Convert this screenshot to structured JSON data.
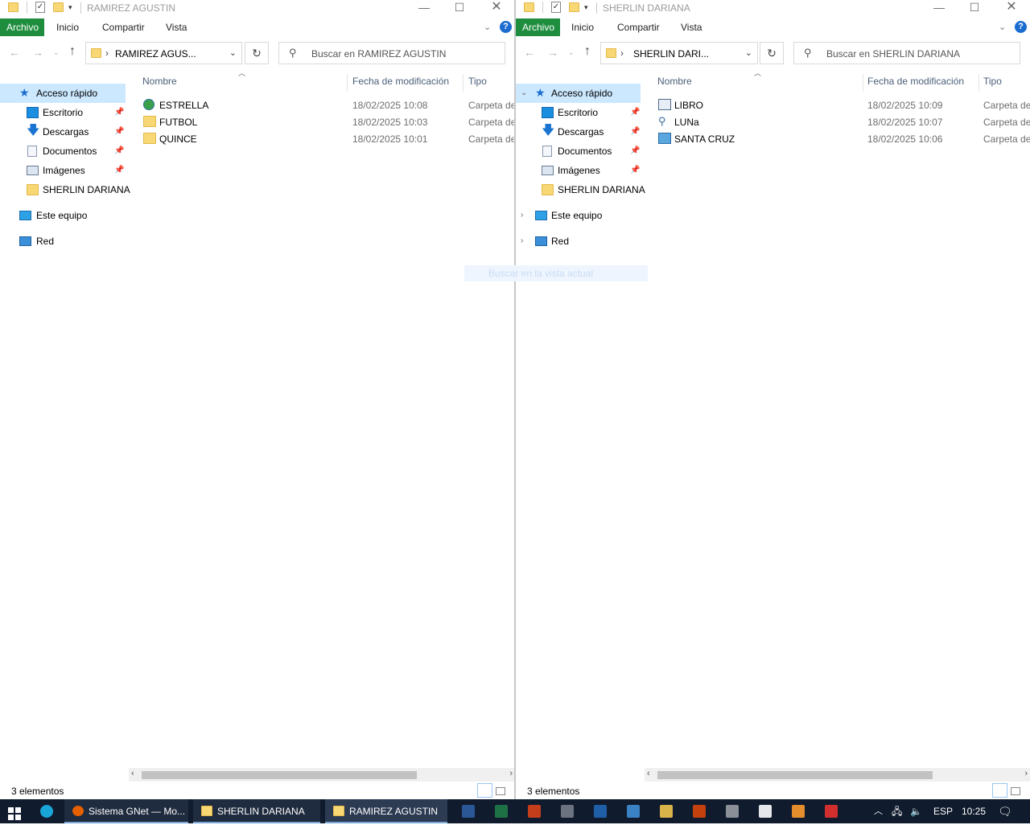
{
  "left_window": {
    "title": "RAMIREZ AGUSTIN",
    "menu": {
      "file": "Archivo",
      "home": "Inicio",
      "share": "Compartir",
      "view": "Vista"
    },
    "address": "RAMIREZ AGUS...",
    "search_placeholder": "Buscar en RAMIREZ AGUSTIN",
    "nav": {
      "quick_access": "Acceso rápido",
      "desktop": "Escritorio",
      "downloads": "Descargas",
      "documents": "Documentos",
      "images": "Imágenes",
      "pinned_folder": "SHERLIN DARIANA",
      "this_pc": "Este equipo",
      "network": "Red"
    },
    "columns": {
      "name": "Nombre",
      "date": "Fecha de modificación",
      "type": "Tipo"
    },
    "files": [
      {
        "name": "ESTRELLA",
        "date": "18/02/2025 10:08",
        "type": "Carpeta de",
        "icon": "globe-folder-icon"
      },
      {
        "name": "FUTBOL",
        "date": "18/02/2025 10:03",
        "type": "Carpeta de",
        "icon": "folder-icon"
      },
      {
        "name": "QUINCE",
        "date": "18/02/2025 10:01",
        "type": "Carpeta de",
        "icon": "folder-icon"
      }
    ],
    "status": "3 elementos"
  },
  "right_window": {
    "title": "SHERLIN DARIANA",
    "menu": {
      "file": "Archivo",
      "home": "Inicio",
      "share": "Compartir",
      "view": "Vista"
    },
    "address": "SHERLIN DARI...",
    "search_placeholder": "Buscar en SHERLIN DARIANA",
    "nav": {
      "quick_access": "Acceso rápido",
      "desktop": "Escritorio",
      "downloads": "Descargas",
      "documents": "Documentos",
      "images": "Imágenes",
      "pinned_folder": "SHERLIN DARIANA",
      "this_pc": "Este equipo",
      "network": "Red"
    },
    "columns": {
      "name": "Nombre",
      "date": "Fecha de modificación",
      "type": "Tipo"
    },
    "files": [
      {
        "name": "LIBRO",
        "date": "18/02/2025 10:09",
        "type": "Carpeta de",
        "icon": "library-folder-icon"
      },
      {
        "name": "LUNa",
        "date": "18/02/2025 10:07",
        "type": "Carpeta de",
        "icon": "search-folder-icon"
      },
      {
        "name": "SANTA CRUZ",
        "date": "18/02/2025 10:06",
        "type": "Carpeta de",
        "icon": "computer-folder-icon"
      }
    ],
    "status": "3 elementos"
  },
  "ghost_tooltip": "Buscar en la vista actual",
  "taskbar": {
    "tasks": [
      {
        "label": "Sistema GNet — Mo...",
        "icon": "firefox-icon"
      },
      {
        "label": "SHERLIN DARIANA",
        "icon": "folder-icon"
      },
      {
        "label": "RAMIREZ AGUSTIN",
        "icon": "folder-icon"
      }
    ],
    "language": "ESP",
    "time": "10:25"
  }
}
